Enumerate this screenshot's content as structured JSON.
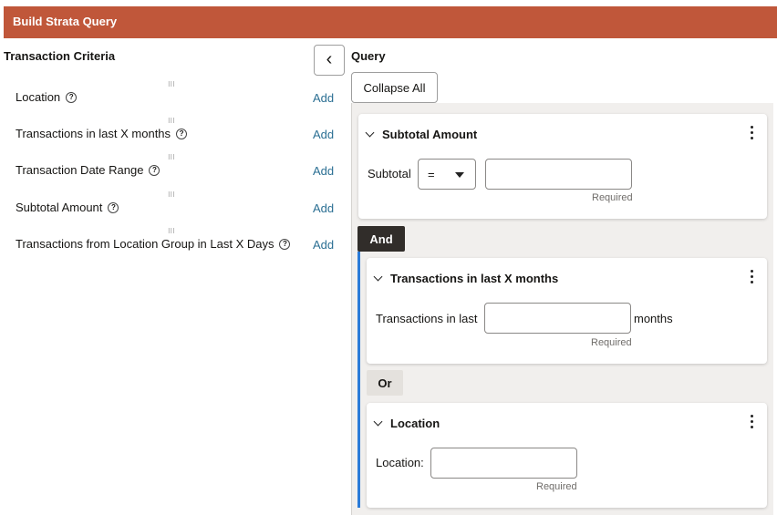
{
  "header": {
    "title": "Build Strata Query"
  },
  "criteria": {
    "title": "Transaction Criteria",
    "add_label": "Add",
    "help_glyph": "?",
    "grip_glyph": "⁝⁝⁝",
    "items": [
      {
        "label": "Location"
      },
      {
        "label": "Transactions in last X months"
      },
      {
        "label": "Transaction Date Range"
      },
      {
        "label": "Subtotal Amount"
      },
      {
        "label": "Transactions from Location Group in Last X Days"
      }
    ]
  },
  "query": {
    "title": "Query",
    "collapse_all_label": "Collapse All",
    "collapse_panel_glyph": "‹",
    "required_text": "Required",
    "and_label": "And",
    "or_label": "Or",
    "cards": {
      "subtotal": {
        "title": "Subtotal Amount",
        "field_label": "Subtotal",
        "operator": "=",
        "value": ""
      },
      "months": {
        "title": "Transactions in last X months",
        "field_label": "Transactions in last",
        "suffix": "months",
        "value": ""
      },
      "location": {
        "title": "Location",
        "field_label": "Location:",
        "value": ""
      }
    }
  },
  "colors": {
    "header": "#c0573a",
    "and_badge": "#312d2a",
    "link": "#2b6f93",
    "group_bar": "#2b7bd8"
  }
}
